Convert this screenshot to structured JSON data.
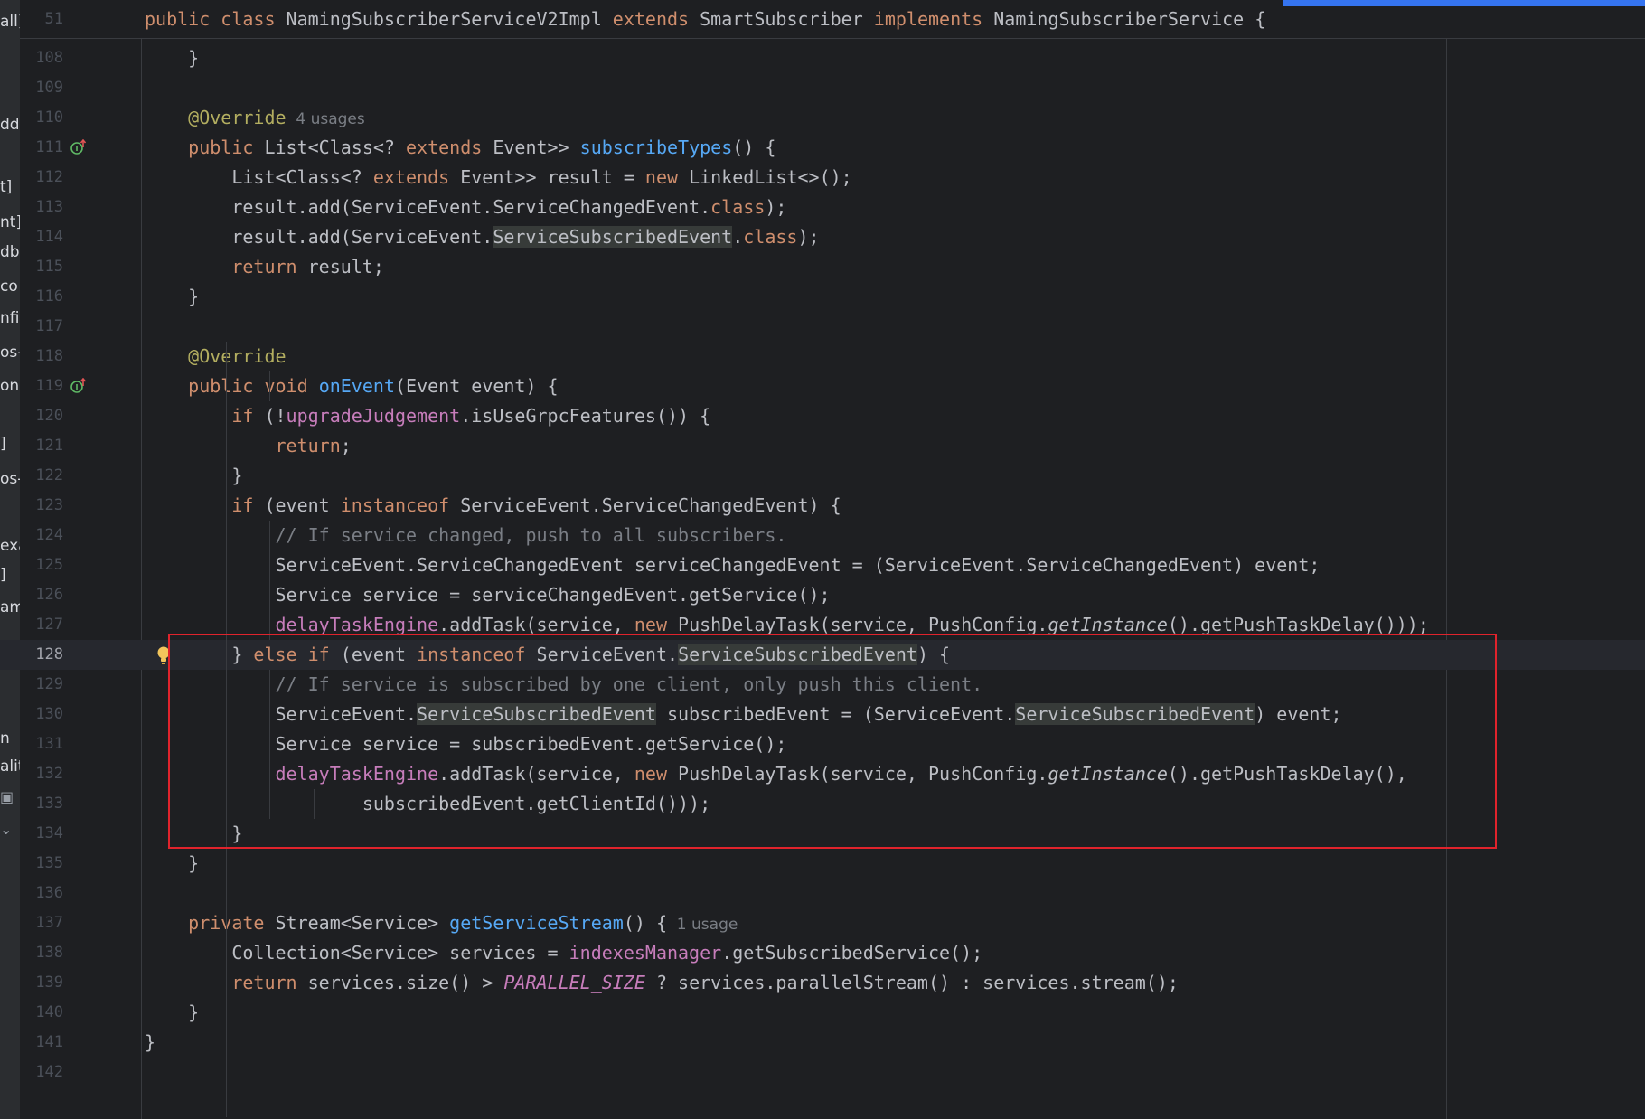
{
  "colors": {
    "background": "#1e1f22",
    "keyword": "#cf8e6d",
    "method": "#56a8f5",
    "annotation": "#b3ae60",
    "field": "#c77dbb",
    "comment": "#7a7e85",
    "highlight_box": "#e0232c",
    "progress": "#3574f0"
  },
  "left_fragments": [
    "all]",
    "dd",
    "t]",
    "nt]",
    "db",
    "co",
    "nfi",
    "os-",
    "on",
    "]",
    "os-",
    "exa",
    "]",
    "am",
    "n",
    "alit",
    "camera-icon",
    "chevron-down-icon"
  ],
  "sticky_header": {
    "line_number": "51",
    "tokens": [
      [
        "public",
        "kw"
      ],
      [
        " ",
        ""
      ],
      [
        "class",
        "kw"
      ],
      [
        " NamingSubscriberServiceV2Impl ",
        ""
      ],
      [
        "extends",
        "kw"
      ],
      [
        " SmartSubscriber ",
        ""
      ],
      [
        "implements",
        "kw"
      ],
      [
        " NamingSubscriberService {",
        ""
      ]
    ]
  },
  "current_line": "128",
  "lines": [
    {
      "n": "108",
      "tokens": [
        [
          "    }",
          ""
        ]
      ]
    },
    {
      "n": "109",
      "tokens": []
    },
    {
      "n": "110",
      "tokens": [
        [
          "    ",
          ""
        ],
        [
          "@Override",
          "ann"
        ]
      ],
      "hint": "4 usages"
    },
    {
      "n": "111",
      "icon": "implements-up-icon",
      "tokens": [
        [
          "    ",
          ""
        ],
        [
          "public",
          "kw"
        ],
        [
          " List<Class<? ",
          ""
        ],
        [
          "extends",
          "kw"
        ],
        [
          " Event>> ",
          ""
        ],
        [
          "subscribeTypes",
          "fn"
        ],
        [
          "() {",
          ""
        ]
      ]
    },
    {
      "n": "112",
      "tokens": [
        [
          "        List<Class<? ",
          ""
        ],
        [
          "extends",
          "kw"
        ],
        [
          " Event>> result = ",
          ""
        ],
        [
          "new",
          "kw"
        ],
        [
          " LinkedList<>();",
          ""
        ]
      ]
    },
    {
      "n": "113",
      "tokens": [
        [
          "        result.add(ServiceEvent.ServiceChangedEvent.",
          ""
        ],
        [
          "class",
          "kw"
        ],
        [
          ");",
          ""
        ]
      ]
    },
    {
      "n": "114",
      "tokens": [
        [
          "        result.add(ServiceEvent.",
          ""
        ],
        [
          "ServiceSubscribedEvent",
          "hl"
        ],
        [
          ".",
          ""
        ],
        [
          "class",
          "kw"
        ],
        [
          ");",
          ""
        ]
      ]
    },
    {
      "n": "115",
      "tokens": [
        [
          "        ",
          ""
        ],
        [
          "return",
          "kw"
        ],
        [
          " result;",
          ""
        ]
      ]
    },
    {
      "n": "116",
      "tokens": [
        [
          "    }",
          ""
        ]
      ]
    },
    {
      "n": "117",
      "tokens": []
    },
    {
      "n": "118",
      "tokens": [
        [
          "    ",
          ""
        ],
        [
          "@Override",
          "ann"
        ]
      ]
    },
    {
      "n": "119",
      "icon": "implements-up-icon",
      "tokens": [
        [
          "    ",
          ""
        ],
        [
          "public",
          "kw"
        ],
        [
          " ",
          ""
        ],
        [
          "void",
          "kw"
        ],
        [
          " ",
          ""
        ],
        [
          "onEvent",
          "fn"
        ],
        [
          "(Event event) {",
          ""
        ]
      ]
    },
    {
      "n": "120",
      "tokens": [
        [
          "        ",
          ""
        ],
        [
          "if",
          "kw"
        ],
        [
          " (!",
          ""
        ],
        [
          "upgradeJudgement",
          "fld"
        ],
        [
          ".isUseGrpcFeatures()) {",
          ""
        ]
      ]
    },
    {
      "n": "121",
      "tokens": [
        [
          "            ",
          ""
        ],
        [
          "return",
          "kw"
        ],
        [
          ";",
          ""
        ]
      ]
    },
    {
      "n": "122",
      "tokens": [
        [
          "        }",
          ""
        ]
      ]
    },
    {
      "n": "123",
      "tokens": [
        [
          "        ",
          ""
        ],
        [
          "if",
          "kw"
        ],
        [
          " (event ",
          ""
        ],
        [
          "instanceof",
          "kw"
        ],
        [
          " ServiceEvent.ServiceChangedEvent) {",
          ""
        ]
      ]
    },
    {
      "n": "124",
      "tokens": [
        [
          "            ",
          ""
        ],
        [
          "// If service changed, push to all subscribers.",
          "cmt"
        ]
      ]
    },
    {
      "n": "125",
      "tokens": [
        [
          "            ServiceEvent.ServiceChangedEvent serviceChangedEvent = (ServiceEvent.ServiceChangedEvent) event;",
          ""
        ]
      ]
    },
    {
      "n": "126",
      "tokens": [
        [
          "            Service service = serviceChangedEvent.getService();",
          ""
        ]
      ]
    },
    {
      "n": "127",
      "tokens": [
        [
          "            ",
          ""
        ],
        [
          "delayTaskEngine",
          "fld"
        ],
        [
          ".addTask(service, ",
          ""
        ],
        [
          "new",
          "kw"
        ],
        [
          " PushDelayTask(service, PushConfig.",
          ""
        ],
        [
          "getInstance",
          "ita"
        ],
        [
          "().getPushTaskDelay()));",
          ""
        ]
      ]
    },
    {
      "n": "128",
      "bulb": true,
      "tokens": [
        [
          "        } ",
          ""
        ],
        [
          "else",
          "kw"
        ],
        [
          " ",
          ""
        ],
        [
          "if",
          "kw"
        ],
        [
          " (event ",
          ""
        ],
        [
          "instanceof",
          "kw"
        ],
        [
          " ServiceEvent.",
          ""
        ],
        [
          "ServiceSubscribedEvent",
          "hl"
        ],
        [
          ") {",
          ""
        ]
      ]
    },
    {
      "n": "129",
      "tokens": [
        [
          "            ",
          ""
        ],
        [
          "// If service is subscribed by one client, only push this client.",
          "cmt"
        ]
      ]
    },
    {
      "n": "130",
      "tokens": [
        [
          "            ServiceEvent.",
          ""
        ],
        [
          "ServiceSubscribedEvent",
          "hl"
        ],
        [
          " subscribedEvent = (ServiceEvent.",
          ""
        ],
        [
          "ServiceSubscribedEvent",
          "hl"
        ],
        [
          ") event;",
          ""
        ]
      ]
    },
    {
      "n": "131",
      "tokens": [
        [
          "            Service service = subscribedEvent.getService();",
          ""
        ]
      ]
    },
    {
      "n": "132",
      "tokens": [
        [
          "            ",
          ""
        ],
        [
          "delayTaskEngine",
          "fld"
        ],
        [
          ".addTask(service, ",
          ""
        ],
        [
          "new",
          "kw"
        ],
        [
          " PushDelayTask(service, PushConfig.",
          ""
        ],
        [
          "getInstance",
          "ita"
        ],
        [
          "().getPushTaskDelay(),",
          ""
        ]
      ]
    },
    {
      "n": "133",
      "tokens": [
        [
          "                    subscribedEvent.getClientId()));",
          ""
        ]
      ]
    },
    {
      "n": "134",
      "tokens": [
        [
          "        }",
          ""
        ]
      ]
    },
    {
      "n": "135",
      "tokens": [
        [
          "    }",
          ""
        ]
      ]
    },
    {
      "n": "136",
      "tokens": []
    },
    {
      "n": "137",
      "tokens": [
        [
          "    ",
          ""
        ],
        [
          "private",
          "kw"
        ],
        [
          " Stream<Service> ",
          ""
        ],
        [
          "getServiceStream",
          "fn"
        ],
        [
          "() {",
          ""
        ]
      ],
      "hint": "1 usage"
    },
    {
      "n": "138",
      "tokens": [
        [
          "        Collection<Service> services = ",
          ""
        ],
        [
          "indexesManager",
          "fld"
        ],
        [
          ".getSubscribedService();",
          ""
        ]
      ]
    },
    {
      "n": "139",
      "tokens": [
        [
          "        ",
          ""
        ],
        [
          "return",
          "kw"
        ],
        [
          " services.size() > ",
          ""
        ],
        [
          "PARALLEL_SIZE",
          "cst"
        ],
        [
          " ? services.parallelStream() : services.stream();",
          ""
        ]
      ]
    },
    {
      "n": "140",
      "tokens": [
        [
          "    }",
          ""
        ]
      ]
    },
    {
      "n": "141",
      "tokens": [
        [
          "}",
          ""
        ]
      ]
    },
    {
      "n": "142",
      "tokens": []
    }
  ]
}
